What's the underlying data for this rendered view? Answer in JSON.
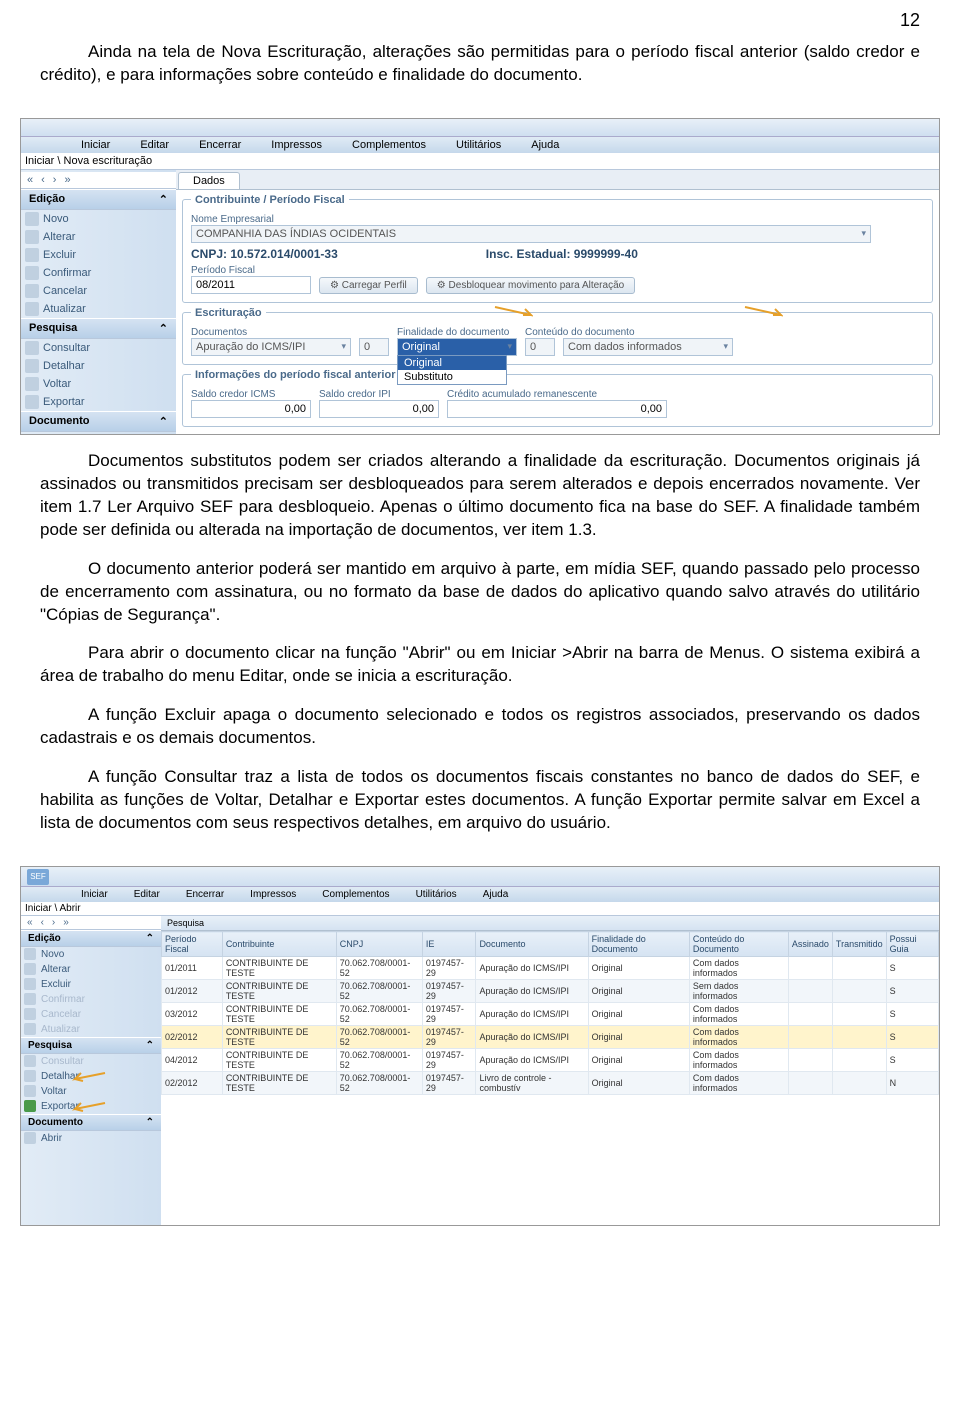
{
  "page_number": "12",
  "para1": "Ainda na tela de Nova Escrituração, alterações são permitidas para o período fiscal anterior (saldo credor e crédito), e para informações sobre conteúdo e finalidade do documento.",
  "para2": "Documentos substitutos podem ser criados alterando a finalidade da escrituração. Documentos originais já assinados ou transmitidos precisam ser desbloqueados para serem alterados e depois encerrados novamente. Ver item 1.7 Ler Arquivo SEF para desbloqueio. Apenas o último documento fica na base do SEF. A finalidade também pode ser definida ou alterada na importação de documentos, ver item 1.3.",
  "para3": "O documento anterior poderá ser mantido em arquivo à parte, em mídia SEF, quando passado pelo processo de encerramento com assinatura, ou no formato da base de dados do aplicativo quando salvo através do utilitário \"Cópias de Segurança\".",
  "para4": "Para abrir o documento clicar na função \"Abrir\" ou em Iniciar >Abrir na barra de Menus. O sistema exibirá a área de trabalho do menu Editar, onde se inicia a escrituração.",
  "para5": "A função Excluir apaga o documento selecionado e todos os registros associados, preservando os dados cadastrais e os demais documentos.",
  "para6": "A função Consultar traz a lista de todos os documentos fiscais constantes no banco de dados do SEF, e habilita as funções de Voltar, Detalhar e Exportar estes documentos. A função Exportar permite salvar em Excel a lista de documentos com seus respectivos detalhes, em arquivo do usuário.",
  "app1": {
    "menus": [
      "Iniciar",
      "Editar",
      "Encerrar",
      "Impressos",
      "Complementos",
      "Utilitários",
      "Ajuda"
    ],
    "breadcrumb": "Iniciar \\ Nova escrituração",
    "side_edicao": "Edição",
    "side_pesquisa": "Pesquisa",
    "side_documento": "Documento",
    "items_ed": [
      "Novo",
      "Alterar",
      "Excluir",
      "Confirmar",
      "Cancelar",
      "Atualizar"
    ],
    "items_pq": [
      "Consultar",
      "Detalhar",
      "Voltar",
      "Exportar"
    ],
    "tab_dados": "Dados",
    "fs1_legend": "Contribuinte / Período Fiscal",
    "lbl_nome": "Nome Empresarial",
    "nome_val": "COMPANHIA DAS ÍNDIAS OCIDENTAIS",
    "cnpj_line": "CNPJ: 10.572.014/0001-33",
    "insc_line": "Insc. Estadual: 9999999-40",
    "lbl_periodo": "Período Fiscal",
    "periodo_val": "08/2011",
    "btn_carregar": "Carregar Perfil",
    "btn_desbloq": "Desbloquear movimento para Alteração",
    "fs2_legend": "Escrituração",
    "lbl_doc": "Documentos",
    "doc_val": "Apuração do ICMS/IPI",
    "doc_num": "0",
    "lbl_finalidade": "Finalidade do documento",
    "fin_selected": "Original",
    "fin_opts": [
      "Original",
      "Substituto"
    ],
    "lbl_conteudo": "Conteúdo do documento",
    "cont_num": "0",
    "cont_val": "Com dados informados",
    "fs3_legend": "Informações do período fiscal anterior",
    "lbl_saldo_icms": "Saldo credor ICMS",
    "lbl_saldo_ipi": "Saldo credor IPI",
    "lbl_credito": "Crédito acumulado remanescente",
    "zero": "0,00"
  },
  "app2": {
    "menus": [
      "Iniciar",
      "Editar",
      "Encerrar",
      "Impressos",
      "Complementos",
      "Utilitários",
      "Ajuda"
    ],
    "breadcrumb": "Iniciar \\ Abrir",
    "side_edicao": "Edição",
    "side_pesquisa": "Pesquisa",
    "side_documento": "Documento",
    "items_ed": [
      "Novo",
      "Alterar",
      "Excluir",
      "Confirmar",
      "Cancelar",
      "Atualizar"
    ],
    "items_pq": [
      "Consultar",
      "Detalhar",
      "Voltar",
      "Exportar"
    ],
    "items_doc": [
      "Abrir"
    ],
    "grid_title": "Pesquisa",
    "cols": [
      "Período Fiscal",
      "Contribuinte",
      "CNPJ",
      "IE",
      "Documento",
      "Finalidade do Documento",
      "Conteúdo do Documento",
      "Assinado",
      "Transmitido",
      "Possui Guia"
    ],
    "rows": [
      [
        "01/2011",
        "CONTRIBUINTE DE TESTE",
        "70.062.708/0001-52",
        "0197457-29",
        "Apuração do ICMS/IPI",
        "Original",
        "Com dados informados",
        "",
        "",
        "S"
      ],
      [
        "01/2012",
        "CONTRIBUINTE DE TESTE",
        "70.062.708/0001-52",
        "0197457-29",
        "Apuração do ICMS/IPI",
        "Original",
        "Sem dados informados",
        "",
        "",
        "S"
      ],
      [
        "03/2012",
        "CONTRIBUINTE DE TESTE",
        "70.062.708/0001-52",
        "0197457-29",
        "Apuração do ICMS/IPI",
        "Original",
        "Com dados informados",
        "",
        "",
        "S"
      ],
      [
        "02/2012",
        "CONTRIBUINTE DE TESTE",
        "70.062.708/0001-52",
        "0197457-29",
        "Apuração do ICMS/IPI",
        "Original",
        "Com dados informados",
        "",
        "",
        "S"
      ],
      [
        "04/2012",
        "CONTRIBUINTE DE TESTE",
        "70.062.708/0001-52",
        "0197457-29",
        "Apuração do ICMS/IPI",
        "Original",
        "Com dados informados",
        "",
        "",
        "S"
      ],
      [
        "02/2012",
        "CONTRIBUINTE DE TESTE",
        "70.062.708/0001-52",
        "0197457-29",
        "Livro de controle - combustív",
        "Original",
        "Com dados informados",
        "",
        "",
        "N"
      ]
    ]
  }
}
